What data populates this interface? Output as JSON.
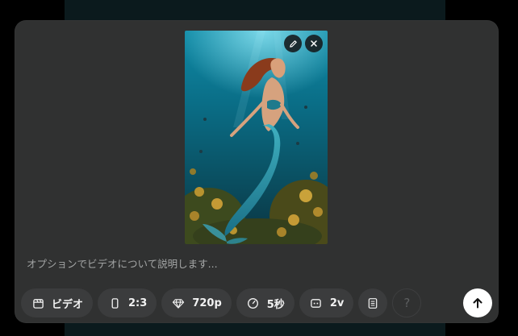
{
  "composer": {
    "prompt_placeholder": "オプションでビデオについて説明します...",
    "attachment": {
      "edit_icon": "pencil-icon",
      "remove_icon": "close-icon"
    },
    "toolbar": {
      "mode_label": "ビデオ",
      "aspect_label": "2:3",
      "quality_label": "720p",
      "duration_label": "5秒",
      "count_label": "2v",
      "help_label": "?"
    },
    "send_icon": "arrow-up-icon"
  },
  "colors": {
    "panel": "#303131",
    "chip": "#3b3c3d",
    "send_button": "#ffffff"
  }
}
